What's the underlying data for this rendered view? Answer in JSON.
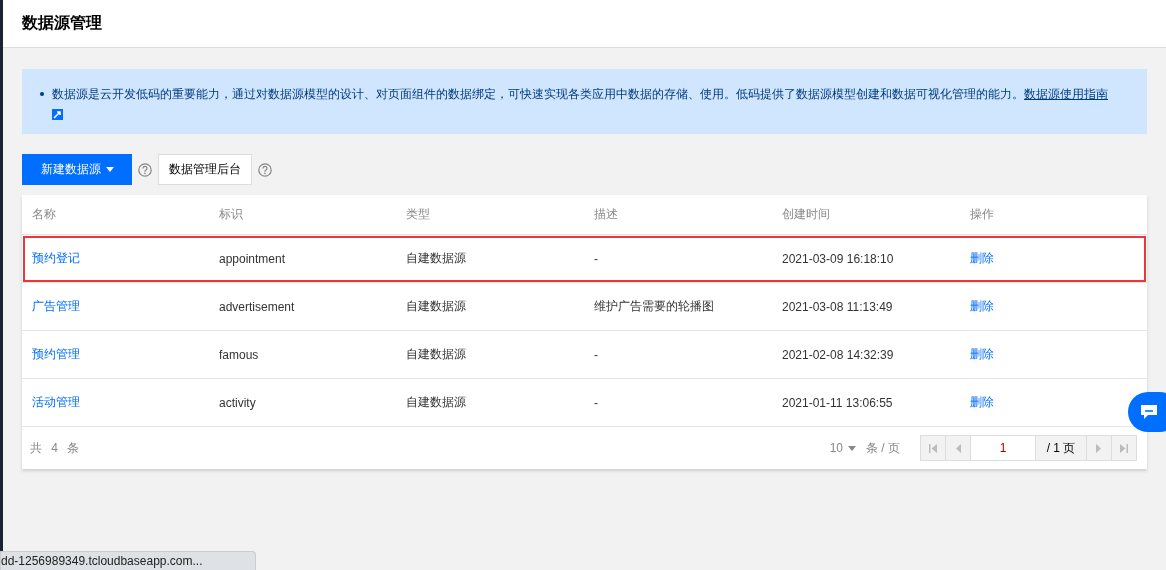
{
  "page_title": "数据源管理",
  "notice": {
    "text": "数据源是云开发低码的重要能力，通过对数据源模型的设计、对页面组件的数据绑定，可快速实现各类应用中数据的存储、使用。低码提供了数据源模型创建和数据可视化管理的能力。",
    "link": "数据源使用指南"
  },
  "toolbar": {
    "primary_button": "新建数据源",
    "secondary_button": "数据管理后台"
  },
  "table": {
    "columns": [
      "名称",
      "标识",
      "类型",
      "描述",
      "创建时间",
      "操作"
    ],
    "rows": [
      {
        "name": "预约登记",
        "id": "appointment",
        "type": "自建数据源",
        "description": "-",
        "created": "2021-03-09 16:18:10",
        "action": "删除",
        "highlighted": true
      },
      {
        "name": "广告管理",
        "id": "advertisement",
        "type": "自建数据源",
        "description": "维护广告需要的轮播图",
        "created": "2021-03-08 11:13:49",
        "action": "删除",
        "highlighted": false
      },
      {
        "name": "预约管理",
        "id": "famous",
        "type": "自建数据源",
        "description": "-",
        "created": "2021-02-08 14:32:39",
        "action": "删除",
        "highlighted": false
      },
      {
        "name": "活动管理",
        "id": "activity",
        "type": "自建数据源",
        "description": "-",
        "created": "2021-01-11 13:06:55",
        "action": "删除",
        "highlighted": false
      }
    ]
  },
  "pagination": {
    "total": "共 4 条",
    "page_size": "10",
    "page_size_unit": "条 / 页",
    "page_input": "1",
    "page_total": "/ 1 页"
  },
  "status_bar": "dd-1256989349.tcloudbaseapp.com..."
}
